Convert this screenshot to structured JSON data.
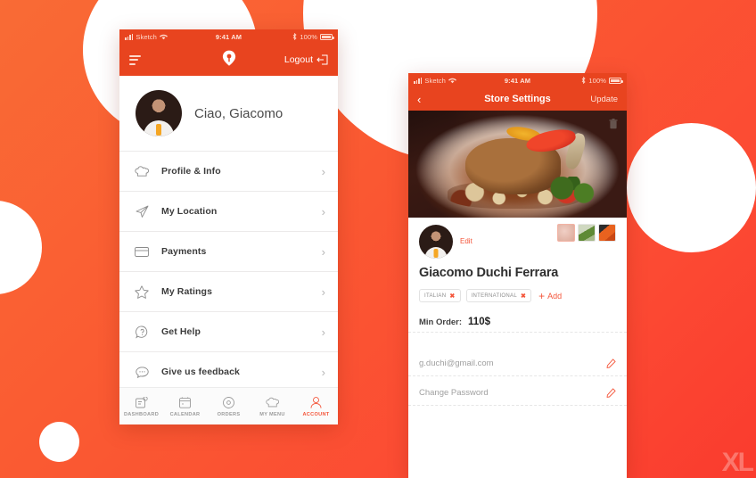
{
  "background": {
    "gradient_from": "#f96b35",
    "gradient_to": "#fa3b2e",
    "circle_color": "#ffffff",
    "watermark": "XL"
  },
  "phone_left": {
    "status_bar": {
      "carrier": "Sketch",
      "time": "9:41 AM",
      "battery": "100%",
      "wifi_icon": "wifi-icon",
      "signal_icon": "signal-bars-icon",
      "bluetooth_icon": "bluetooth-icon",
      "battery_icon": "battery-full-icon"
    },
    "nav": {
      "menu_icon": "hamburger-menu-icon",
      "logo_icon": "location-pin-icon",
      "logout_label": "Logout",
      "logout_icon": "logout-arrow-icon"
    },
    "profile": {
      "greeting": "Ciao, Giacomo",
      "avatar_icon": "user-avatar"
    },
    "menu_items": [
      {
        "label": "Profile & Info",
        "icon": "chef-hat-icon"
      },
      {
        "label": "My Location",
        "icon": "paper-plane-icon"
      },
      {
        "label": "Payments",
        "icon": "credit-card-icon"
      },
      {
        "label": "My Ratings",
        "icon": "star-outline-icon"
      },
      {
        "label": "Get Help",
        "icon": "question-bubble-icon"
      },
      {
        "label": "Give us feedback",
        "icon": "chat-bubble-icon"
      }
    ],
    "tabs": [
      {
        "label": "DASHBOARD",
        "icon": "dashboard-icon",
        "active": false
      },
      {
        "label": "CALENDAR",
        "icon": "calendar-icon",
        "active": false
      },
      {
        "label": "ORDERS",
        "icon": "orders-disc-icon",
        "active": false
      },
      {
        "label": "MY MENU",
        "icon": "chef-hat-icon",
        "active": false
      },
      {
        "label": "ACCOUNT",
        "icon": "person-icon",
        "active": true
      }
    ],
    "accent_color": "#f4553a"
  },
  "phone_right": {
    "status_bar": {
      "carrier": "Sketch",
      "time": "9:41 AM",
      "battery": "100%"
    },
    "nav": {
      "back_icon": "chevron-left-icon",
      "title": "Store Settings",
      "update_label": "Update"
    },
    "hero": {
      "alt": "plated lamb shank with peppers and beans",
      "delete_icon": "trash-icon"
    },
    "profile": {
      "avatar_icon": "user-avatar",
      "edit_label": "Edit",
      "thumbnails": [
        "food-thumbnail-meat",
        "food-thumbnail-salad",
        "food-thumbnail-vegetables"
      ]
    },
    "store_name": "Giacomo Duchi Ferrara",
    "tags": [
      "ITALIAN",
      "INTERNATIONAL"
    ],
    "add_label": "Add",
    "min_order": {
      "label": "Min Order:",
      "value": "110$"
    },
    "fields": [
      {
        "text": "g.duchi@gmail.com",
        "icon": "pencil-edit-icon"
      },
      {
        "text": "Change Password",
        "icon": "pencil-edit-icon"
      }
    ],
    "accent_color": "#f4553a"
  }
}
